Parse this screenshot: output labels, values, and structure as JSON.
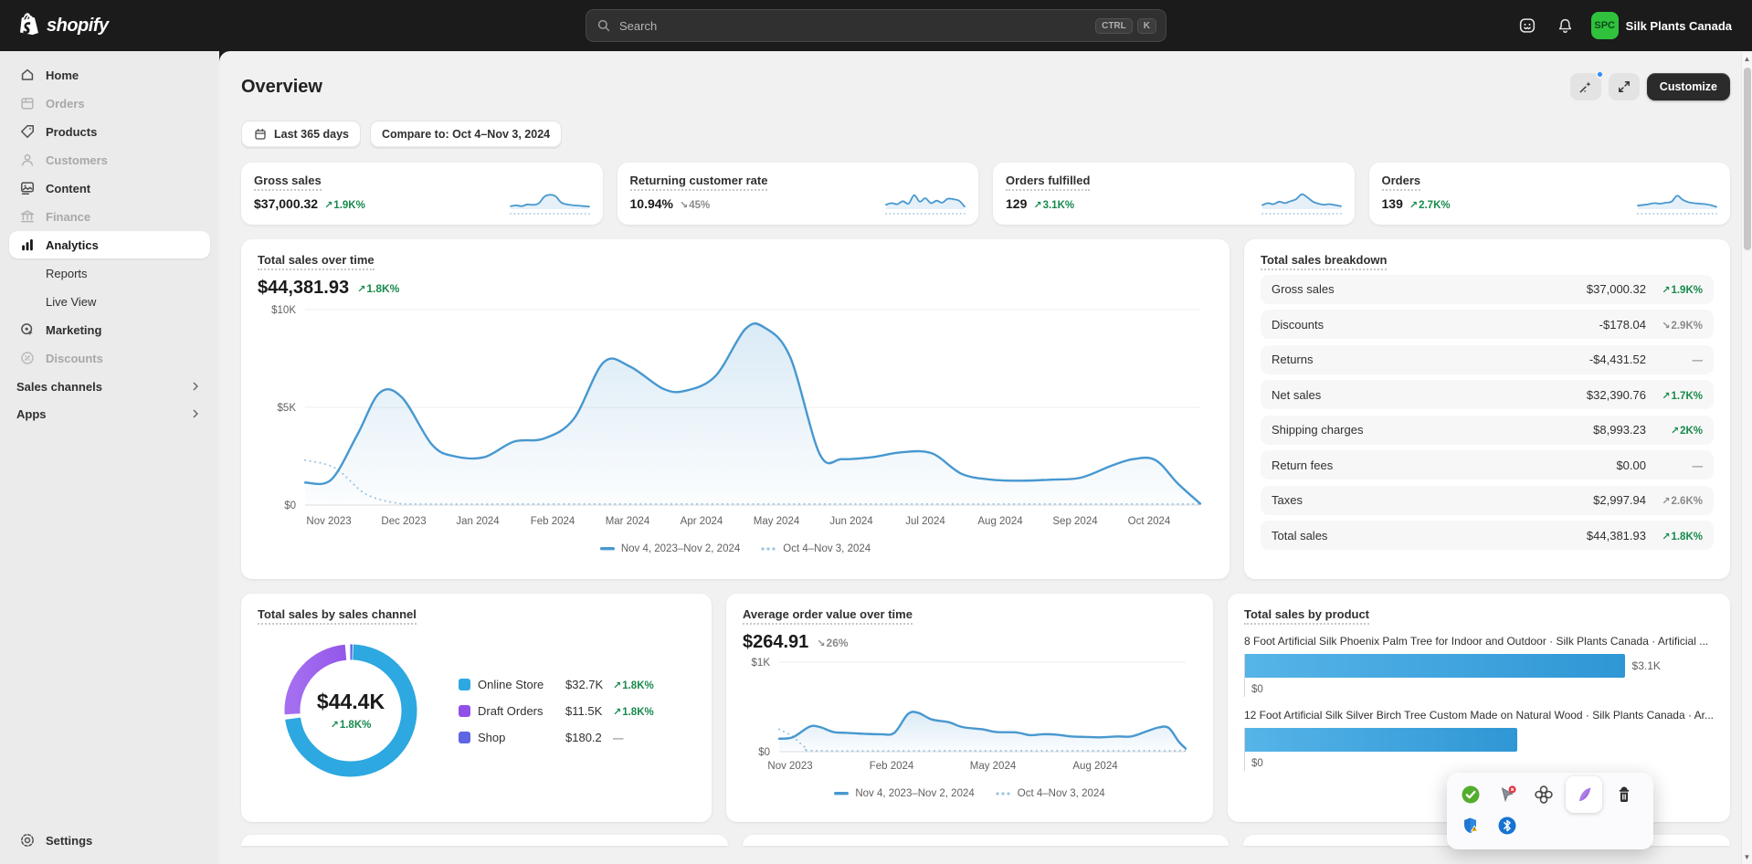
{
  "topbar": {
    "brand": "shopify",
    "search": {
      "placeholder": "Search",
      "shortcut": [
        "CTRL",
        "K"
      ]
    },
    "store": {
      "initials": "SPC",
      "name": "Silk Plants Canada"
    }
  },
  "sidebar": {
    "items": [
      {
        "id": "home",
        "label": "Home",
        "icon": "home-icon",
        "state": "default"
      },
      {
        "id": "orders",
        "label": "Orders",
        "icon": "orders-icon",
        "state": "disabled"
      },
      {
        "id": "products",
        "label": "Products",
        "icon": "products-icon",
        "state": "default"
      },
      {
        "id": "customers",
        "label": "Customers",
        "icon": "customers-icon",
        "state": "disabled"
      },
      {
        "id": "content",
        "label": "Content",
        "icon": "content-icon",
        "state": "default"
      },
      {
        "id": "finance",
        "label": "Finance",
        "icon": "finance-icon",
        "state": "disabled"
      },
      {
        "id": "analytics",
        "label": "Analytics",
        "icon": "analytics-icon",
        "state": "active"
      },
      {
        "id": "reports",
        "label": "Reports",
        "icon": null,
        "state": "sub"
      },
      {
        "id": "live-view",
        "label": "Live View",
        "icon": null,
        "state": "sub"
      },
      {
        "id": "marketing",
        "label": "Marketing",
        "icon": "marketing-icon",
        "state": "default"
      },
      {
        "id": "discounts",
        "label": "Discounts",
        "icon": "discounts-icon",
        "state": "disabled"
      }
    ],
    "sections": [
      {
        "id": "sales-channels",
        "label": "Sales channels"
      },
      {
        "id": "apps",
        "label": "Apps"
      }
    ],
    "settings": {
      "label": "Settings"
    }
  },
  "header": {
    "title": "Overview",
    "customize_label": "Customize"
  },
  "filters": {
    "date_range": "Last 365 days",
    "compare": "Compare to: Oct 4–Nov 3, 2024"
  },
  "colors": {
    "positive": "#178a4c",
    "neutral": "#8a8a8a",
    "line_blue": "#4798d0",
    "compare_blue": "#9cc3de",
    "donut_blue": "#2da8e0",
    "donut_purple": "#9050e8",
    "donut_indigo": "#5f65e3",
    "bar_blue_start": "#56b4e8",
    "bar_blue_end": "#2f97d5"
  },
  "metrics": {
    "cards": [
      {
        "title": "Gross sales",
        "value": "$37,000.32",
        "change": "1.9K%",
        "direction": "up",
        "tone": "positive",
        "spark": [
          1.6,
          1.9,
          1.6,
          2.3,
          2.1,
          2.7,
          5.4,
          6.2,
          5.6,
          3.1,
          2.3,
          2.0,
          1.8,
          1.6,
          1.4
        ]
      },
      {
        "title": "Returning customer rate",
        "value": "10.94%",
        "change": "45%",
        "direction": "down",
        "tone": "neutral",
        "spark": [
          2.2,
          2.8,
          2.4,
          3.6,
          2.6,
          6.0,
          3.4,
          4.8,
          2.8,
          3.8,
          3.0,
          4.6,
          4.4,
          3.8,
          1.4
        ]
      },
      {
        "title": "Orders fulfilled",
        "value": "129",
        "change": "3.1K%",
        "direction": "up",
        "tone": "positive",
        "spark": [
          2.0,
          2.8,
          2.4,
          3.4,
          2.8,
          3.6,
          4.4,
          6.4,
          5.2,
          3.4,
          2.6,
          2.2,
          2.4,
          2.0,
          1.6
        ]
      },
      {
        "title": "Orders",
        "value": "139",
        "change": "2.7K%",
        "direction": "up",
        "tone": "positive",
        "spark": [
          1.8,
          2.1,
          2.4,
          2.8,
          2.6,
          3.0,
          3.4,
          5.8,
          4.2,
          3.2,
          2.8,
          2.6,
          2.4,
          2.0,
          1.3
        ]
      }
    ]
  },
  "chart_data": [
    {
      "id": "total_sales_over_time",
      "type": "area",
      "title": "Total sales over time",
      "headline_value": "$44,381.93",
      "change": "1.8K%",
      "direction": "up",
      "tone": "positive",
      "ylim": [
        0,
        10000
      ],
      "ytick_labels": [
        "$10K",
        "$5K",
        "$0"
      ],
      "grid": true,
      "legend_position": "bottom",
      "x_labels": [
        {
          "label": "Nov 2023",
          "m": 0
        },
        {
          "label": "Dec 2023",
          "m": 1
        },
        {
          "label": "Jan 2024",
          "m": 2
        },
        {
          "label": "Feb 2024",
          "m": 3
        },
        {
          "label": "Mar 2024",
          "m": 4
        },
        {
          "label": "Apr 2024",
          "m": 5
        },
        {
          "label": "May 2024",
          "m": 6
        },
        {
          "label": "Jun 2024",
          "m": 7
        },
        {
          "label": "Jul 2024",
          "m": 8
        },
        {
          "label": "Aug 2024",
          "m": 9
        },
        {
          "label": "Sep 2024",
          "m": 10
        },
        {
          "label": "Oct 2024",
          "m": 11
        }
      ],
      "series": [
        {
          "name": "Nov 4, 2023–Nov 2, 2024",
          "style": "solid",
          "points": [
            [
              0,
              1150
            ],
            [
              0.35,
              1300
            ],
            [
              0.7,
              3600
            ],
            [
              1.0,
              5750
            ],
            [
              1.3,
              5500
            ],
            [
              1.7,
              3100
            ],
            [
              2.0,
              2500
            ],
            [
              2.4,
              2450
            ],
            [
              2.8,
              3250
            ],
            [
              3.2,
              3400
            ],
            [
              3.6,
              4400
            ],
            [
              4.0,
              7300
            ],
            [
              4.35,
              7100
            ],
            [
              4.8,
              5950
            ],
            [
              5.1,
              5850
            ],
            [
              5.5,
              6600
            ],
            [
              5.9,
              9000
            ],
            [
              6.15,
              9100
            ],
            [
              6.5,
              7600
            ],
            [
              6.9,
              2600
            ],
            [
              7.2,
              2350
            ],
            [
              7.6,
              2450
            ],
            [
              8.0,
              2700
            ],
            [
              8.4,
              2650
            ],
            [
              8.8,
              1600
            ],
            [
              9.2,
              1300
            ],
            [
              9.6,
              1250
            ],
            [
              10.0,
              1300
            ],
            [
              10.4,
              1400
            ],
            [
              10.8,
              2000
            ],
            [
              11.1,
              2350
            ],
            [
              11.4,
              2300
            ],
            [
              11.7,
              1100
            ],
            [
              12,
              70
            ]
          ]
        },
        {
          "name": "Oct 4–Nov 3, 2024",
          "style": "dotted",
          "points": [
            [
              0,
              2300
            ],
            [
              0.4,
              1900
            ],
            [
              0.8,
              600
            ],
            [
              1.2,
              120
            ],
            [
              1.6,
              50
            ],
            [
              3,
              50
            ],
            [
              6,
              50
            ],
            [
              9,
              50
            ],
            [
              12,
              50
            ]
          ]
        }
      ]
    },
    {
      "id": "total_sales_breakdown",
      "type": "table",
      "title": "Total sales breakdown",
      "rows": [
        {
          "label": "Gross sales",
          "value": "$37,000.32",
          "change": "1.9K%",
          "direction": "up",
          "tone": "positive"
        },
        {
          "label": "Discounts",
          "value": "-$178.04",
          "change": "2.9K%",
          "direction": "down",
          "tone": "neutral"
        },
        {
          "label": "Returns",
          "value": "-$4,431.52",
          "change": "—",
          "direction": "none",
          "tone": "neutral"
        },
        {
          "label": "Net sales",
          "value": "$32,390.76",
          "change": "1.7K%",
          "direction": "up",
          "tone": "positive"
        },
        {
          "label": "Shipping charges",
          "value": "$8,993.23",
          "change": "2K%",
          "direction": "up",
          "tone": "positive"
        },
        {
          "label": "Return fees",
          "value": "$0.00",
          "change": "—",
          "direction": "none",
          "tone": "neutral"
        },
        {
          "label": "Taxes",
          "value": "$2,997.94",
          "change": "2.6K%",
          "direction": "up",
          "tone": "neutral"
        },
        {
          "label": "Total sales",
          "value": "$44,381.93",
          "change": "1.8K%",
          "direction": "up",
          "tone": "positive"
        }
      ]
    },
    {
      "id": "total_sales_by_channel",
      "type": "donut",
      "title": "Total sales by sales channel",
      "center_value": "$44.4K",
      "change": "1.8K%",
      "direction": "up",
      "tone": "positive",
      "segments": [
        {
          "label": "Online Store",
          "value_label": "$32.7K",
          "value": 32700,
          "pct": 73.4,
          "color": "#2da8e0",
          "change": "1.8K%",
          "direction": "up",
          "tone": "positive"
        },
        {
          "label": "Draft Orders",
          "value_label": "$11.5K",
          "value": 11500,
          "pct": 25.8,
          "color": "#9050e8",
          "change": "1.8K%",
          "direction": "up",
          "tone": "positive"
        },
        {
          "label": "Shop",
          "value_label": "$180.2",
          "value": 180.2,
          "pct": 0.8,
          "color": "#5f65e3",
          "change": "—",
          "direction": "none",
          "tone": "neutral"
        }
      ]
    },
    {
      "id": "aov_over_time",
      "type": "area",
      "title": "Average order value over time",
      "headline_value": "$264.91",
      "change": "26%",
      "direction": "down",
      "tone": "neutral",
      "ylim": [
        0,
        1000
      ],
      "ytick_labels": [
        "$1K",
        "$0"
      ],
      "grid": true,
      "legend_position": "bottom",
      "x_labels": [
        {
          "label": "Nov 2023",
          "m": 0
        },
        {
          "label": "Feb 2024",
          "m": 3
        },
        {
          "label": "May 2024",
          "m": 6
        },
        {
          "label": "Aug 2024",
          "m": 9
        }
      ],
      "series": [
        {
          "name": "Nov 4, 2023–Nov 2, 2024",
          "style": "solid",
          "points": [
            [
              0,
              145
            ],
            [
              0.4,
              160
            ],
            [
              0.9,
              280
            ],
            [
              1.2,
              275
            ],
            [
              1.6,
              220
            ],
            [
              2.0,
              210
            ],
            [
              2.5,
              200
            ],
            [
              3.0,
              195
            ],
            [
              3.4,
              210
            ],
            [
              3.8,
              420
            ],
            [
              4.1,
              435
            ],
            [
              4.5,
              360
            ],
            [
              5.0,
              330
            ],
            [
              5.4,
              275
            ],
            [
              6.0,
              250
            ],
            [
              6.4,
              220
            ],
            [
              7.0,
              215
            ],
            [
              7.4,
              185
            ],
            [
              7.8,
              195
            ],
            [
              8.2,
              190
            ],
            [
              8.6,
              170
            ],
            [
              9.0,
              165
            ],
            [
              9.5,
              160
            ],
            [
              10.0,
              170
            ],
            [
              10.4,
              170
            ],
            [
              10.8,
              220
            ],
            [
              11.2,
              270
            ],
            [
              11.5,
              265
            ],
            [
              11.8,
              110
            ],
            [
              12,
              35
            ]
          ]
        },
        {
          "name": "Oct 4–Nov 3, 2024",
          "style": "dotted",
          "points": [
            [
              0,
              250
            ],
            [
              0.4,
              170
            ],
            [
              0.8,
              40
            ],
            [
              1.2,
              10
            ],
            [
              6,
              10
            ],
            [
              12,
              10
            ]
          ]
        }
      ]
    },
    {
      "id": "total_sales_by_product",
      "type": "bar",
      "title": "Total sales by product",
      "items": [
        {
          "label": "8 Foot Artificial Silk Phoenix Palm Tree for Indoor and Outdoor · Silk Plants Canada · Artificial ...",
          "value_label": "$3.1K",
          "pct": 81,
          "axis_label": "$0"
        },
        {
          "label": "12 Foot Artificial Silk Silver Birch Tree Custom Made on Natural Wood · Silk Plants Canada · Ar...",
          "value_label": "",
          "pct": 58,
          "axis_label": "$0"
        }
      ]
    }
  ],
  "ext_toolbar": {
    "row1": [
      "check-badge-icon",
      "cursor-extension-icon",
      "clover-extension-icon",
      "feather-extension-icon",
      "trash-extension-icon"
    ],
    "row2": [
      "shield-warning-icon",
      "bluetooth-icon"
    ]
  }
}
